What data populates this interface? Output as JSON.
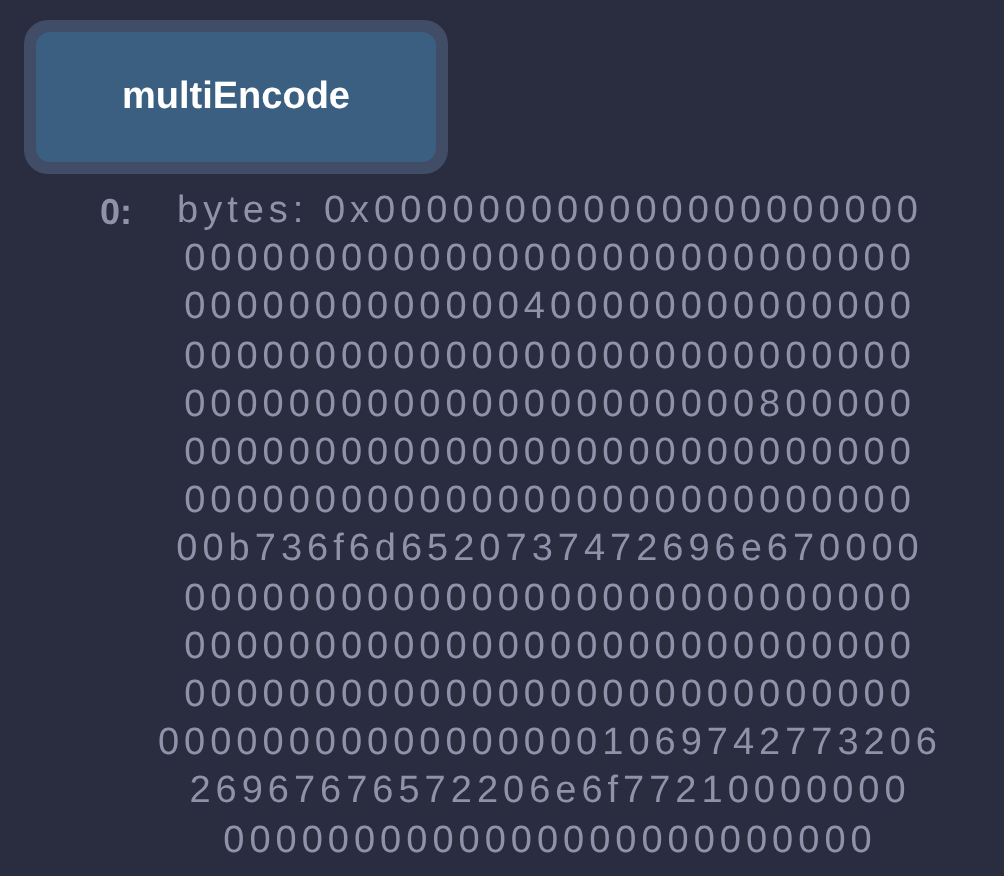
{
  "button": {
    "label": "multiEncode"
  },
  "outputs": [
    {
      "index": "0:",
      "lines": [
        "bytes: 0x000000000000000000000",
        "0000000000000000000000000000",
        "0000000000000400000000000000",
        "0000000000000000000000000000",
        "0000000000000000000000800000",
        "0000000000000000000000000000",
        "0000000000000000000000000000",
        "00b736f6d6520737472696e670000",
        "0000000000000000000000000000",
        "0000000000000000000000000000",
        "0000000000000000000000000000",
        "000000000000000001069742773206",
        "26967676572206e6f77210000000",
        "0000000000000000000000000"
      ]
    }
  ]
}
